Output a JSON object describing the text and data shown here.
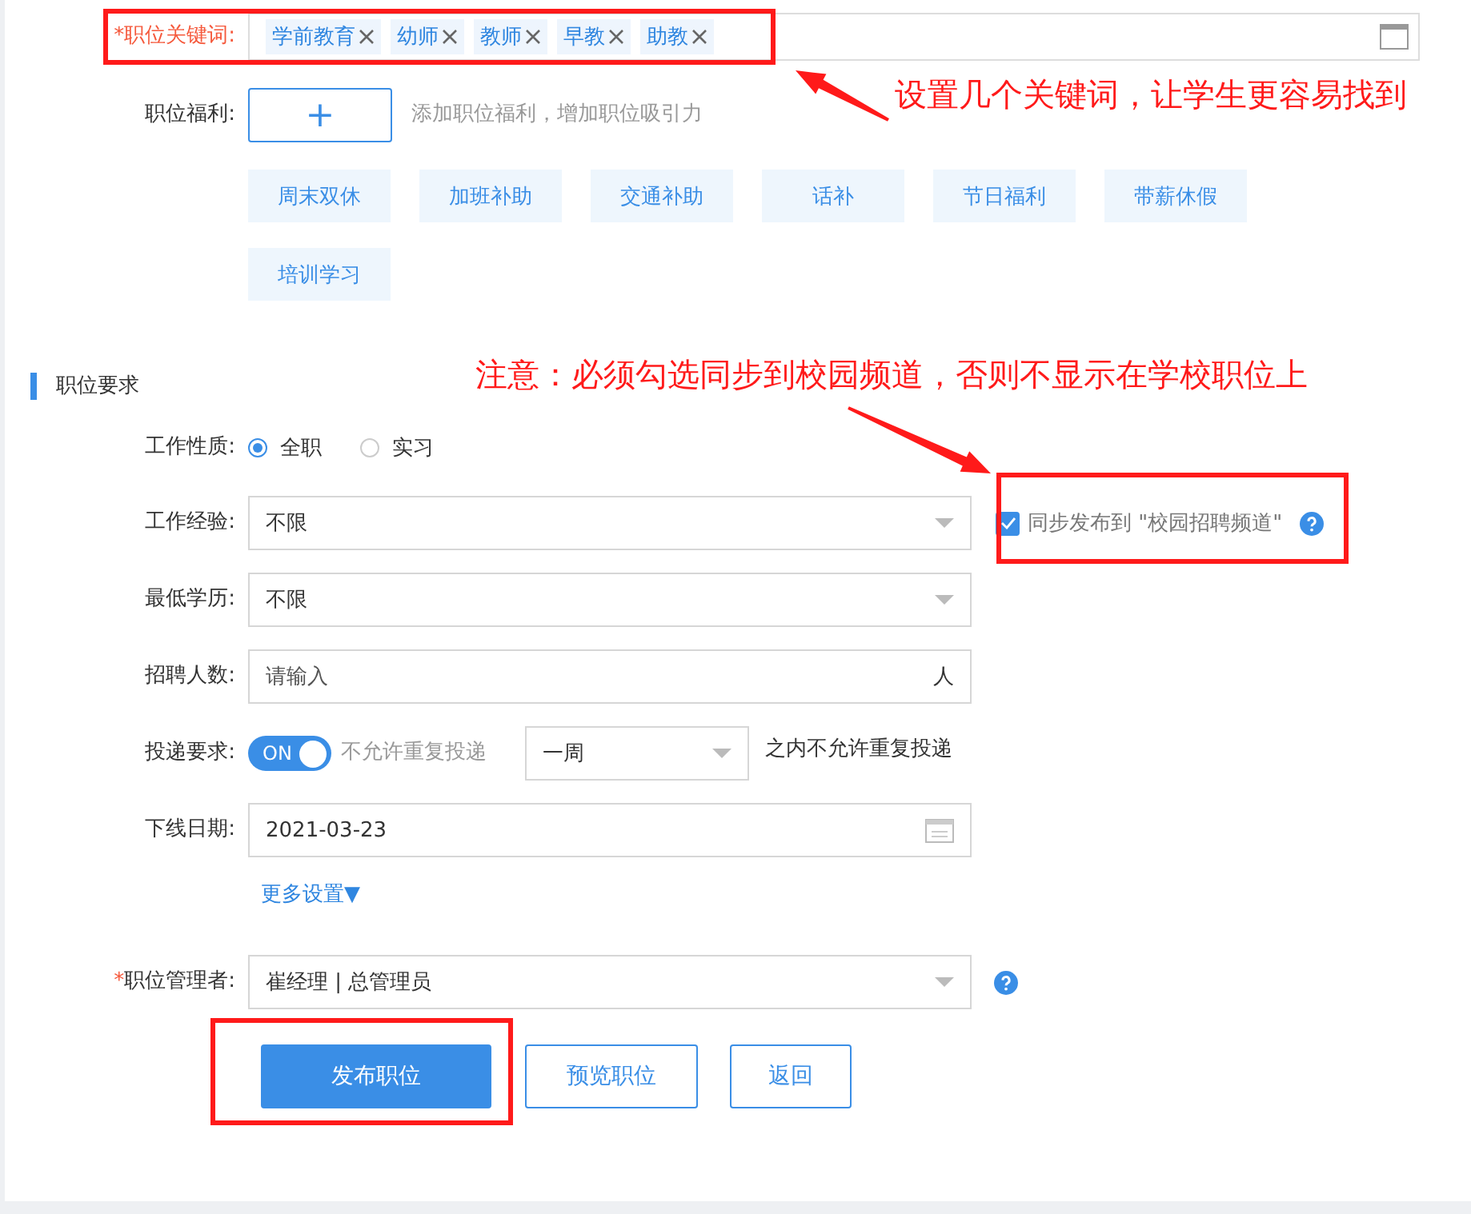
{
  "keywords": {
    "label": "*职位关键词:",
    "tags": [
      "学前教育",
      "幼师",
      "教师",
      "早教",
      "助教"
    ]
  },
  "benefits": {
    "label": "职位福利:",
    "add": "+",
    "hint": "添加职位福利，增加职位吸引力",
    "options": [
      "周末双休",
      "加班补助",
      "交通补助",
      "话补",
      "节日福利",
      "带薪休假",
      "培训学习"
    ]
  },
  "section_title": "职位要求",
  "fields": [
    {
      "kind": "radio",
      "label": "工作性质:",
      "options": [
        {
          "label": "全职",
          "selected": true
        },
        {
          "label": "实习",
          "selected": false
        }
      ]
    },
    {
      "kind": "select",
      "label": "工作经验:",
      "value": "不限",
      "sync": {
        "label": "同步发布到 \"校园招聘频道\"",
        "checked": true
      }
    },
    {
      "kind": "select",
      "label": "最低学历:",
      "value": "不限"
    },
    {
      "kind": "input",
      "label": "招聘人数:",
      "placeholder": "请输入",
      "suffix": "人"
    },
    {
      "kind": "toggle",
      "label": "投递要求:",
      "on": true,
      "toggle_text": "ON",
      "hint": "不允许重复投递",
      "period": "一周",
      "after": "之内不允许重复投递"
    },
    {
      "kind": "date",
      "label": "下线日期:",
      "value": "2021-03-23"
    }
  ],
  "more_settings": "更多设置▼",
  "manager": {
    "mark": "*",
    "label": "职位管理者:",
    "value": "崔经理 | 总管理员"
  },
  "buttons": [
    {
      "label": "发布职位",
      "primary": true
    },
    {
      "label": "预览职位",
      "primary": false
    },
    {
      "label": "返回",
      "primary": false
    }
  ],
  "notes": [
    "设置几个关键词，让学生更容易找到",
    "注意：必须勾选同步到校园频道，否则不显示在学校职位上"
  ]
}
